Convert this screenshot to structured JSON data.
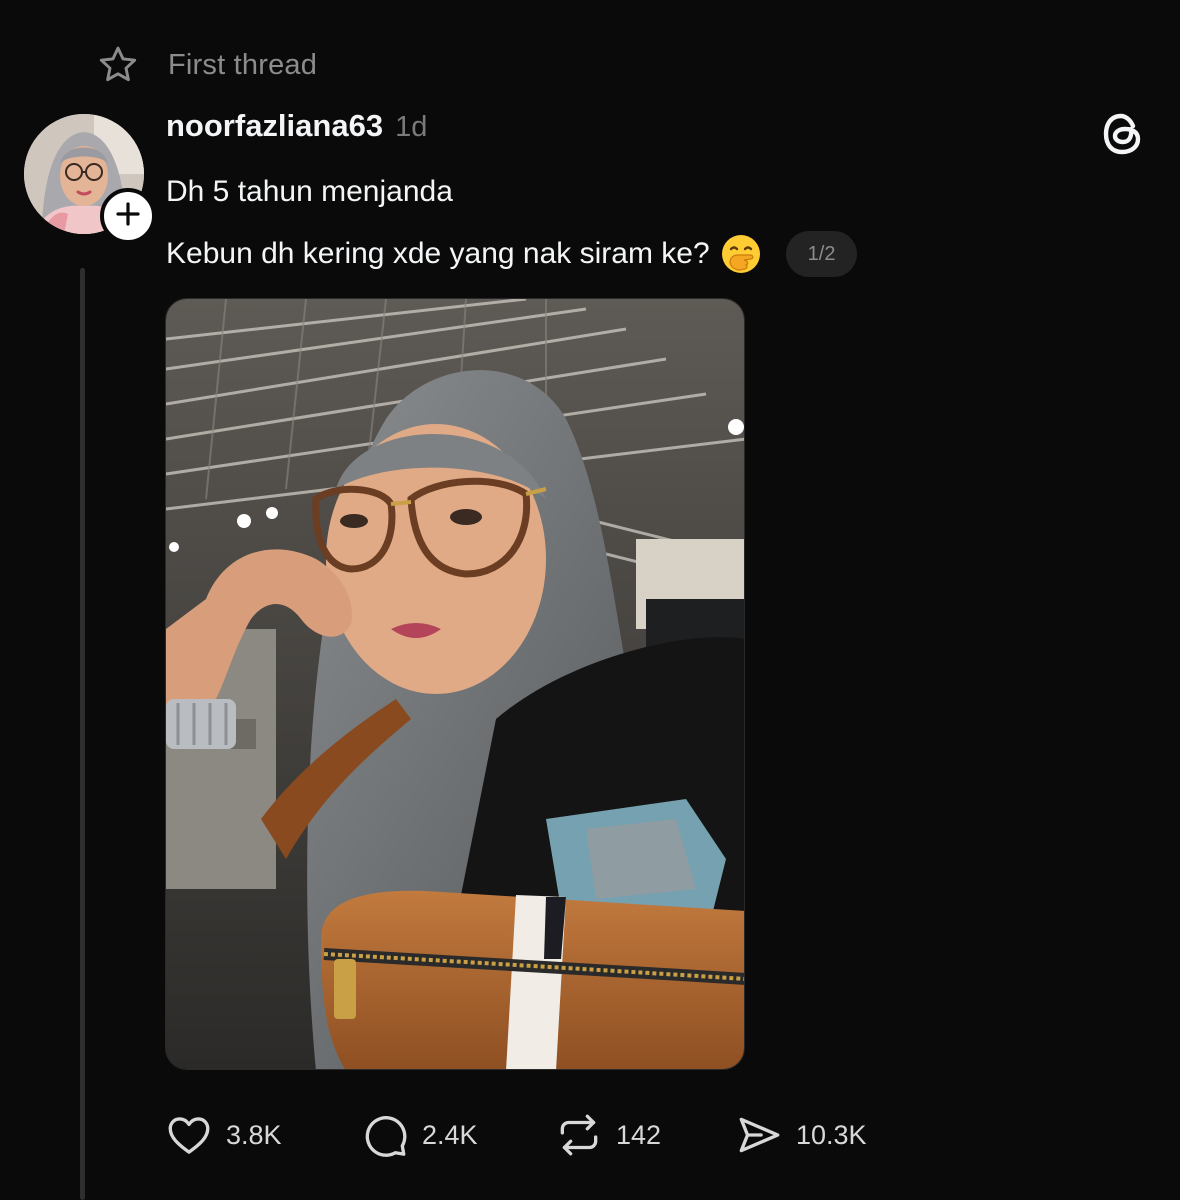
{
  "header": {
    "label": "First thread",
    "star_icon": "star-icon"
  },
  "post": {
    "author": {
      "username": "noorfazliana63",
      "timestamp": "1d",
      "follow_icon": "plus-icon"
    },
    "text_line1": "Dh 5 tahun menjanda",
    "text_line2": "Kebun dh kering xde yang nak siram ke?",
    "emoji": "face-with-hand-over-mouth-icon",
    "page_indicator": "1/2",
    "image_description_icon": "post-photo",
    "actions": {
      "likes": "3.8K",
      "replies": "2.4K",
      "reposts": "142",
      "shares": "10.3K"
    }
  },
  "app": {
    "logo_icon": "threads-logo-icon"
  },
  "colors": {
    "background": "#0a0a0a",
    "text": "#f3f5f7",
    "muted": "#8c8c8c",
    "thread_line": "#2e2e2e"
  }
}
